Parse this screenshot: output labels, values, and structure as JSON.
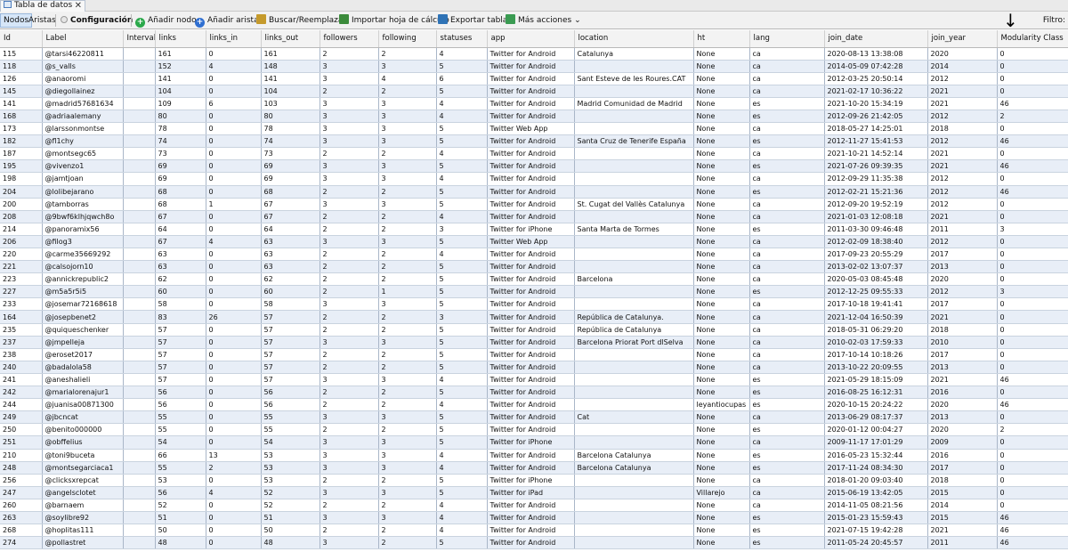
{
  "tab": {
    "title": "Tabla de datos",
    "close": "✕"
  },
  "toolbar": {
    "nodos": "Nodos",
    "aristas": "Aristas",
    "configuracion": "Configuración",
    "add_node": "Añadir nodo",
    "add_edge": "Añadir arista",
    "search_replace": "Buscar/Reemplazar",
    "import": "Importar hoja de cálculo",
    "export": "Exportar tabla",
    "more": "Más acciones",
    "more_arrow": "⌄",
    "filter_label": "Filtro:",
    "annotation_arrow": "↓"
  },
  "columns": [
    "Id",
    "Label",
    "Interval",
    "links",
    "links_in",
    "links_out",
    "followers",
    "following",
    "statuses",
    "app",
    "location",
    "ht",
    "lang",
    "join_date",
    "join_year",
    "Modularity Class"
  ],
  "rows": [
    [
      "115",
      "@tarsi46220811",
      "",
      "161",
      "0",
      "161",
      "2",
      "2",
      "4",
      "Twitter for Android",
      "Catalunya",
      "None",
      "ca",
      "2020-08-13 13:38:08",
      "2020",
      "0"
    ],
    [
      "118",
      "@s_valls",
      "",
      "152",
      "4",
      "148",
      "3",
      "3",
      "5",
      "Twitter for Android",
      "",
      "None",
      "ca",
      "2014-05-09 07:42:28",
      "2014",
      "0"
    ],
    [
      "126",
      "@anaoromi",
      "",
      "141",
      "0",
      "141",
      "3",
      "4",
      "6",
      "Twitter for Android",
      "Sant Esteve de les Roures.CAT",
      "None",
      "ca",
      "2012-03-25 20:50:14",
      "2012",
      "0"
    ],
    [
      "145",
      "@diegollainez",
      "",
      "104",
      "0",
      "104",
      "2",
      "2",
      "5",
      "Twitter for Android",
      "",
      "None",
      "ca",
      "2021-02-17 10:36:22",
      "2021",
      "0"
    ],
    [
      "141",
      "@madrid57681634",
      "",
      "109",
      "6",
      "103",
      "3",
      "3",
      "4",
      "Twitter for Android",
      "Madrid  Comunidad de Madrid",
      "None",
      "es",
      "2021-10-20 15:34:19",
      "2021",
      "46"
    ],
    [
      "168",
      "@adriaalemany",
      "",
      "80",
      "0",
      "80",
      "3",
      "3",
      "4",
      "Twitter for Android",
      "",
      "None",
      "es",
      "2012-09-26 21:42:05",
      "2012",
      "2"
    ],
    [
      "173",
      "@larssonmontse",
      "",
      "78",
      "0",
      "78",
      "3",
      "3",
      "5",
      "Twitter Web App",
      "",
      "None",
      "ca",
      "2018-05-27 14:25:01",
      "2018",
      "0"
    ],
    [
      "182",
      "@fl1chy",
      "",
      "74",
      "0",
      "74",
      "3",
      "3",
      "5",
      "Twitter for Android",
      "Santa Cruz de Tenerife  España",
      "None",
      "es",
      "2012-11-27 15:41:53",
      "2012",
      "46"
    ],
    [
      "187",
      "@montsegc65",
      "",
      "73",
      "0",
      "73",
      "2",
      "2",
      "4",
      "Twitter for Android",
      "",
      "None",
      "ca",
      "2021-10-21 14:52:14",
      "2021",
      "0"
    ],
    [
      "195",
      "@vivenzo1",
      "",
      "69",
      "0",
      "69",
      "3",
      "3",
      "5",
      "Twitter for Android",
      "",
      "None",
      "es",
      "2021-07-26 09:39:35",
      "2021",
      "46"
    ],
    [
      "198",
      "@jamtjoan",
      "",
      "69",
      "0",
      "69",
      "3",
      "3",
      "4",
      "Twitter for Android",
      "",
      "None",
      "ca",
      "2012-09-29 11:35:38",
      "2012",
      "0"
    ],
    [
      "204",
      "@lolibejarano",
      "",
      "68",
      "0",
      "68",
      "2",
      "2",
      "5",
      "Twitter for Android",
      "",
      "None",
      "es",
      "2012-02-21 15:21:36",
      "2012",
      "46"
    ],
    [
      "200",
      "@tamborras",
      "",
      "68",
      "1",
      "67",
      "3",
      "3",
      "5",
      "Twitter for Android",
      "St. Cugat del Vallès Catalunya",
      "None",
      "ca",
      "2012-09-20 19:52:19",
      "2012",
      "0"
    ],
    [
      "208",
      "@9bwf6klhjqwch8o",
      "",
      "67",
      "0",
      "67",
      "2",
      "2",
      "4",
      "Twitter for Android",
      "",
      "None",
      "ca",
      "2021-01-03 12:08:18",
      "2021",
      "0"
    ],
    [
      "214",
      "@panoramix56",
      "",
      "64",
      "0",
      "64",
      "2",
      "2",
      "3",
      "Twitter for iPhone",
      "Santa Marta de Tormes",
      "None",
      "es",
      "2011-03-30 09:46:48",
      "2011",
      "3"
    ],
    [
      "206",
      "@filog3",
      "",
      "67",
      "4",
      "63",
      "3",
      "3",
      "5",
      "Twitter Web App",
      "",
      "None",
      "ca",
      "2012-02-09 18:38:40",
      "2012",
      "0"
    ],
    [
      "220",
      "@carme35669292",
      "",
      "63",
      "0",
      "63",
      "2",
      "2",
      "4",
      "Twitter for Android",
      "",
      "None",
      "ca",
      "2017-09-23 20:55:29",
      "2017",
      "0"
    ],
    [
      "221",
      "@calsojorn10",
      "",
      "63",
      "0",
      "63",
      "2",
      "2",
      "5",
      "Twitter for Android",
      "",
      "None",
      "ca",
      "2013-02-02 13:07:37",
      "2013",
      "0"
    ],
    [
      "223",
      "@annickrepublic2",
      "",
      "62",
      "0",
      "62",
      "2",
      "2",
      "5",
      "Twitter for Android",
      "Barcelona",
      "None",
      "ca",
      "2020-05-03 08:45:48",
      "2020",
      "0"
    ],
    [
      "227",
      "@m5a5r5i5",
      "",
      "60",
      "0",
      "60",
      "2",
      "1",
      "5",
      "Twitter for Android",
      "",
      "None",
      "es",
      "2012-12-25 09:55:33",
      "2012",
      "3"
    ],
    [
      "233",
      "@josemar72168618",
      "",
      "58",
      "0",
      "58",
      "3",
      "3",
      "5",
      "Twitter for Android",
      "",
      "None",
      "ca",
      "2017-10-18 19:41:41",
      "2017",
      "0"
    ],
    [
      "164",
      "@josepbenet2",
      "",
      "83",
      "26",
      "57",
      "2",
      "2",
      "3",
      "Twitter for Android",
      "República de Catalunya.",
      "None",
      "ca",
      "2021-12-04 16:50:39",
      "2021",
      "0"
    ],
    [
      "235",
      "@quiqueschenker",
      "",
      "57",
      "0",
      "57",
      "2",
      "2",
      "5",
      "Twitter for Android",
      "República de Catalunya",
      "None",
      "ca",
      "2018-05-31 06:29:20",
      "2018",
      "0"
    ],
    [
      "237",
      "@jmpelleja",
      "",
      "57",
      "0",
      "57",
      "3",
      "3",
      "5",
      "Twitter for Android",
      "Barcelona Priorat Port dlSelva",
      "None",
      "ca",
      "2010-02-03 17:59:33",
      "2010",
      "0"
    ],
    [
      "238",
      "@eroset2017",
      "",
      "57",
      "0",
      "57",
      "2",
      "2",
      "5",
      "Twitter for Android",
      "",
      "None",
      "ca",
      "2017-10-14 10:18:26",
      "2017",
      "0"
    ],
    [
      "240",
      "@badalola58",
      "",
      "57",
      "0",
      "57",
      "2",
      "2",
      "5",
      "Twitter for Android",
      "",
      "None",
      "ca",
      "2013-10-22 20:09:55",
      "2013",
      "0"
    ],
    [
      "241",
      "@aneshalieli",
      "",
      "57",
      "0",
      "57",
      "3",
      "3",
      "4",
      "Twitter for Android",
      "",
      "None",
      "es",
      "2021-05-29 18:15:09",
      "2021",
      "46"
    ],
    [
      "242",
      "@marialorenajur1",
      "",
      "56",
      "0",
      "56",
      "2",
      "2",
      "5",
      "Twitter for Android",
      "",
      "None",
      "es",
      "2016-08-25 16:12:31",
      "2016",
      "0"
    ],
    [
      "244",
      "@juanisa00871300",
      "",
      "56",
      "0",
      "56",
      "2",
      "2",
      "4",
      "Twitter for Android",
      "",
      "leyantiocupas",
      "es",
      "2020-10-15 20:24:22",
      "2020",
      "46"
    ],
    [
      "249",
      "@jbcncat",
      "",
      "55",
      "0",
      "55",
      "3",
      "3",
      "5",
      "Twitter for Android",
      "Cat",
      "None",
      "ca",
      "2013-06-29 08:17:37",
      "2013",
      "0"
    ],
    [
      "250",
      "@benito000000",
      "",
      "55",
      "0",
      "55",
      "2",
      "2",
      "5",
      "Twitter for Android",
      "",
      "None",
      "es",
      "2020-01-12 00:04:27",
      "2020",
      "2"
    ],
    [
      "251",
      "@obffelius",
      "",
      "54",
      "0",
      "54",
      "3",
      "3",
      "5",
      "Twitter for iPhone",
      "",
      "None",
      "ca",
      "2009-11-17 17:01:29",
      "2009",
      "0"
    ],
    [
      "210",
      "@toni9buceta",
      "",
      "66",
      "13",
      "53",
      "3",
      "3",
      "4",
      "Twitter for Android",
      "Barcelona  Catalunya",
      "None",
      "es",
      "2016-05-23 15:32:44",
      "2016",
      "0"
    ],
    [
      "248",
      "@montsegarciaca1",
      "",
      "55",
      "2",
      "53",
      "3",
      "3",
      "4",
      "Twitter for Android",
      "Barcelona  Catalunya",
      "None",
      "es",
      "2017-11-24 08:34:30",
      "2017",
      "0"
    ],
    [
      "256",
      "@clicksxrepcat",
      "",
      "53",
      "0",
      "53",
      "2",
      "2",
      "5",
      "Twitter for iPhone",
      "",
      "None",
      "ca",
      "2018-01-20 09:03:40",
      "2018",
      "0"
    ],
    [
      "247",
      "@angelsclotet",
      "",
      "56",
      "4",
      "52",
      "3",
      "3",
      "5",
      "Twitter for iPad",
      "",
      "Villarejo",
      "ca",
      "2015-06-19 13:42:05",
      "2015",
      "0"
    ],
    [
      "260",
      "@barnaem",
      "",
      "52",
      "0",
      "52",
      "2",
      "2",
      "4",
      "Twitter for Android",
      "",
      "None",
      "ca",
      "2014-11-05 08:21:56",
      "2014",
      "0"
    ],
    [
      "263",
      "@soylibre92",
      "",
      "51",
      "0",
      "51",
      "3",
      "3",
      "4",
      "Twitter for Android",
      "",
      "None",
      "es",
      "2015-01-23 15:59:43",
      "2015",
      "46"
    ],
    [
      "268",
      "@hoplitas111",
      "",
      "50",
      "0",
      "50",
      "2",
      "2",
      "4",
      "Twitter for Android",
      "",
      "None",
      "es",
      "2021-07-15 19:42:28",
      "2021",
      "46"
    ],
    [
      "274",
      "@pollastret",
      "",
      "48",
      "0",
      "48",
      "3",
      "2",
      "5",
      "Twitter for Android",
      "",
      "None",
      "es",
      "2011-05-24 20:45:57",
      "2011",
      "46"
    ]
  ]
}
